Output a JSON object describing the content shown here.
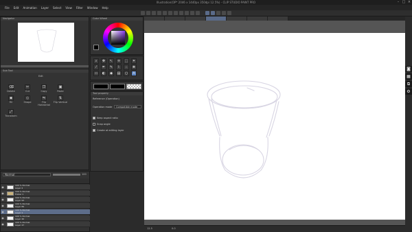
{
  "title": "Illustration(OP* 2046 x 1440px 350dpi 12.5%) - CLIP STUDIO PAINT PRO",
  "menu": [
    "File",
    "Edit",
    "Animation",
    "Layer",
    "Select",
    "View",
    "Filter",
    "Window",
    "Help"
  ],
  "doc_tabs": [
    "",
    "",
    "",
    "",
    "",
    "",
    ""
  ],
  "navigator": {
    "title": "Navigator"
  },
  "color_wheel": {
    "title": "Color Wheel"
  },
  "sub_tool": {
    "title": "Sub Tool",
    "selected": "Edit"
  },
  "sub_tool_items": [
    "Delete",
    "Cut",
    "Copy",
    "Paste",
    "Fill",
    "Shape",
    "Flip Horizontal",
    "Flip Vertical",
    "Transform"
  ],
  "tool_property": {
    "title": "Tool property",
    "header": "Reference (Operation)",
    "mode_label": "Operation mode",
    "mode_value": "Compatible mode",
    "checks": [
      {
        "label": "Keep aspect ratio",
        "on": true
      },
      {
        "label": "Snap angle",
        "on": false
      },
      {
        "label": "Create at editing layer",
        "on": true
      }
    ]
  },
  "layer_panel": {
    "blend": "Normal",
    "opacity": "100"
  },
  "layers": [
    {
      "line1": "100 % Normal",
      "line2": "Layer 2",
      "selected": false
    },
    {
      "line1": "100 % Normal",
      "line2": "Folder 1",
      "selected": false
    },
    {
      "line1": "100 % Normal",
      "line2": "Layer 93",
      "selected": false
    },
    {
      "line1": "100 % Normal",
      "line2": "Layer 89",
      "selected": false
    },
    {
      "line1": "100 % Normal",
      "line2": "Layer 1",
      "selected": true
    },
    {
      "line1": "100 % Normal",
      "line2": "Layer 40",
      "selected": false
    },
    {
      "line1": "100 % Normal",
      "line2": "Layer 47",
      "selected": false
    }
  ],
  "status": {
    "zoom": "12.5",
    "angle": "0.0"
  },
  "right_icons": [
    "camera-icon",
    "film-icon",
    "layers-icon",
    "gear-icon"
  ],
  "colors": {
    "main": "#000000",
    "sub": "#ffffff",
    "canvas": "#ffffff",
    "stroke": "#d8d5e3"
  }
}
